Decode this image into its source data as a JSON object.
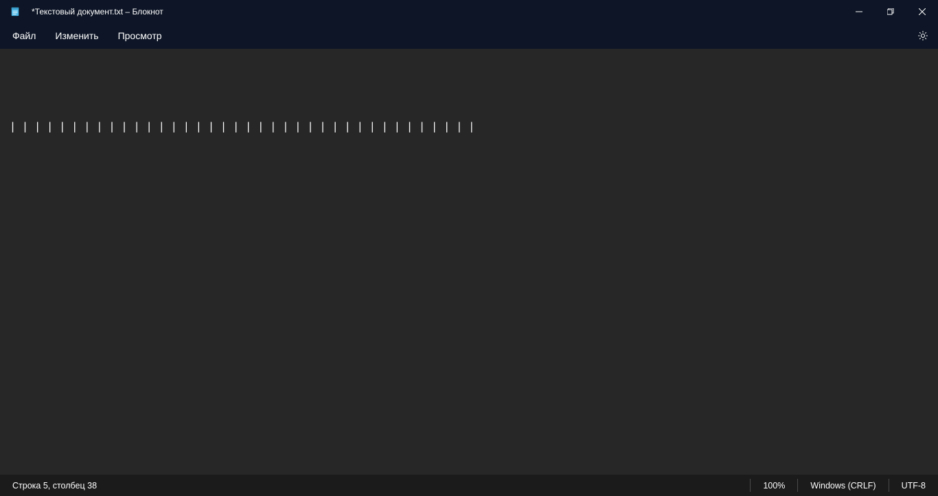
{
  "window": {
    "title": "*Текстовый документ.txt – Блокнот"
  },
  "menu": {
    "file": "Файл",
    "edit": "Изменить",
    "view": "Просмотр"
  },
  "content": {
    "text": "\n\n\n\n| | | | | | | | | | | | | | | | | | | | | | | | | | | | | | | | | | | | | |"
  },
  "status": {
    "position": "Строка 5, столбец 38",
    "zoom": "100%",
    "line_ending": "Windows (CRLF)",
    "encoding": "UTF-8"
  }
}
